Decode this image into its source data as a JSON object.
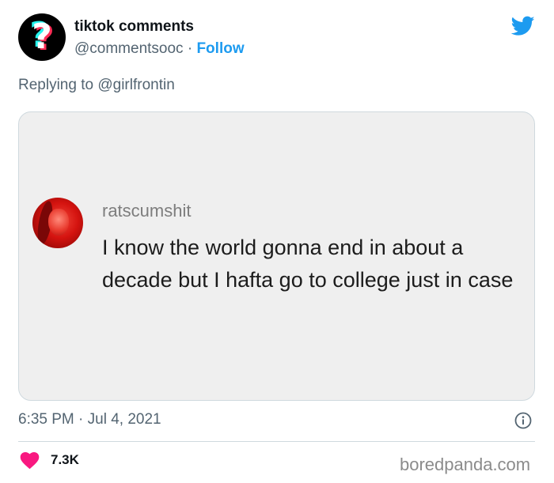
{
  "author": {
    "name": "tiktok comments",
    "handle": "@commentsooc",
    "separator": " · ",
    "follow_label": "Follow"
  },
  "reply": {
    "prefix": "Replying to ",
    "mention": "@girlfrontin"
  },
  "media": {
    "commenter": "ratscumshit",
    "comment": "I know the world gonna end in about a decade but I hafta go to college just in case"
  },
  "footer": {
    "timestamp": "6:35 PM · Jul 4, 2021",
    "likes": "7.3K",
    "watermark": "boredpanda.com"
  },
  "colors": {
    "link": "#1d9bf0",
    "heart": "#f91880",
    "muted": "#536471"
  },
  "icons": [
    "twitter-bird-icon",
    "info-icon",
    "heart-icon"
  ]
}
